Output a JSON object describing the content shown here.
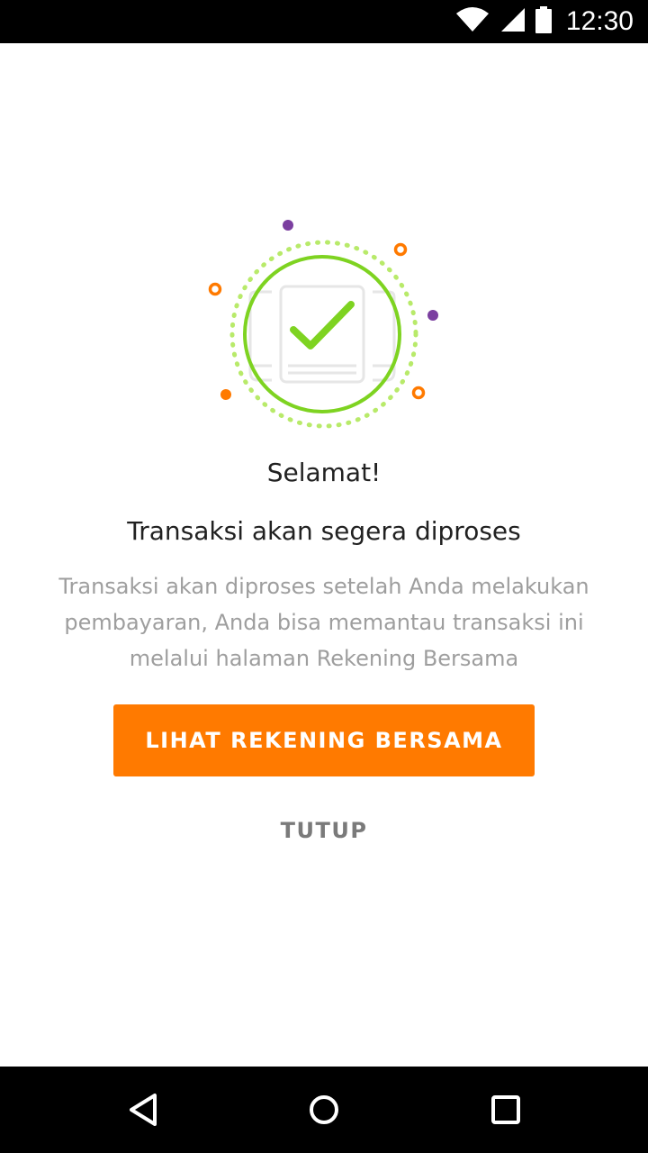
{
  "status_bar": {
    "time": "12:30",
    "icons": [
      "wifi-icon",
      "signal-icon",
      "battery-icon"
    ]
  },
  "success": {
    "title": "Selamat!",
    "subtitle": "Transaksi akan segera diproses",
    "description_lines": [
      "Transaksi akan diproses setelah Anda melakukan",
      "pembayaran, Anda bisa memantau transaksi ini",
      "melalui halaman Rekening Bersama"
    ]
  },
  "actions": {
    "primary_label": "LIHAT REKENING BERSAMA",
    "secondary_label": "TUTUP"
  },
  "nav_bar": {
    "icons": [
      "back-icon",
      "home-icon",
      "recents-icon"
    ]
  },
  "colors": {
    "accent_orange": "#ff7a00",
    "success_green": "#7ed321",
    "dot_purple": "#7b3fa0",
    "text_primary": "#212121",
    "text_secondary": "#9e9e9e"
  }
}
